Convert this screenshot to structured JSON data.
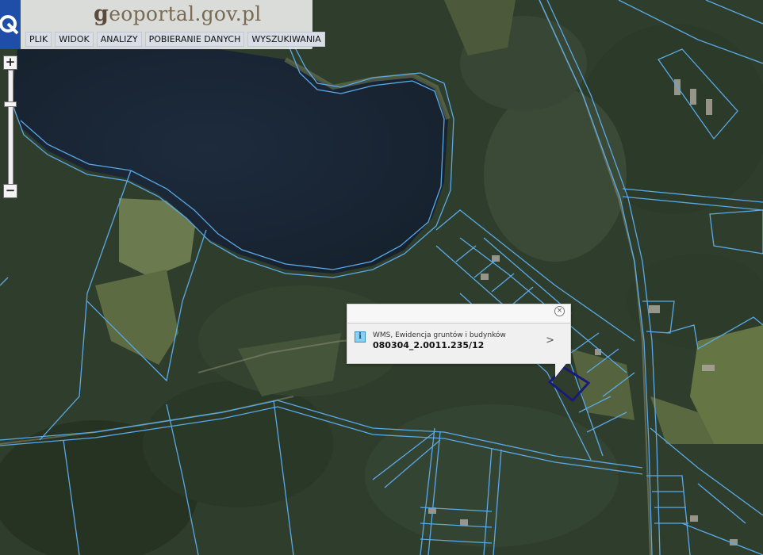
{
  "app": {
    "brand_prefix": "g",
    "brand_rest": "eoportal.gov.pl"
  },
  "menu": {
    "items": [
      {
        "label": "PLIK"
      },
      {
        "label": "WIDOK"
      },
      {
        "label": "ANALIZY"
      },
      {
        "label": "POBIERANIE DANYCH"
      },
      {
        "label": "WYSZUKIWANIA"
      }
    ]
  },
  "zoom": {
    "in_label": "+",
    "out_label": "−"
  },
  "popup": {
    "close_label": "×",
    "layer_name": "WMS, Ewidencja gruntów i budynków",
    "parcel_id": "080304_2.0011.235/12",
    "info_icon_label": "i",
    "more_label": ">"
  },
  "colors": {
    "parcel_lines": "#5aa9e6",
    "selected_parcel": "#1a1a7a",
    "lake": "#1e2c3e",
    "forest": "#2d3b2b",
    "header_accent": "#1f4ea8"
  }
}
